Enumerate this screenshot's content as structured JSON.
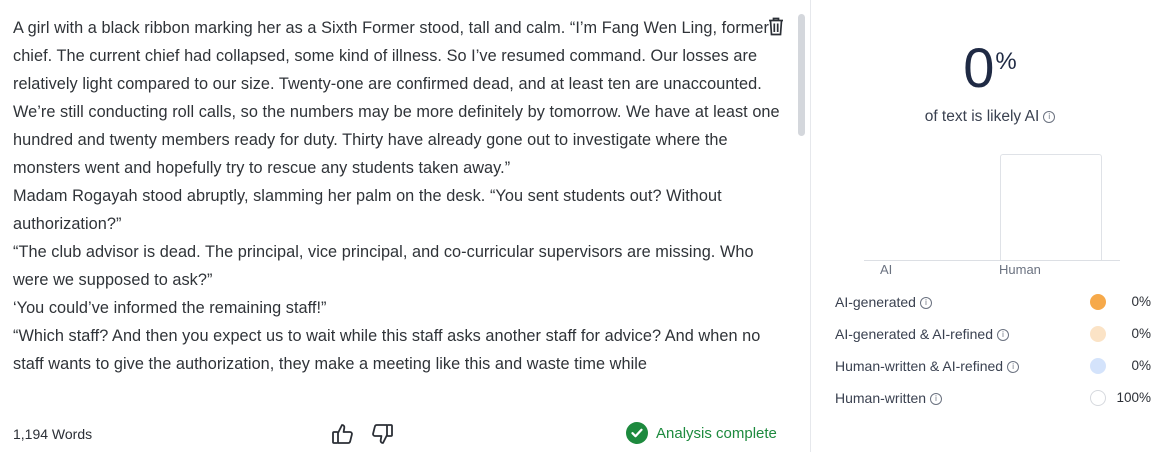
{
  "editor": {
    "paragraphs": [
      "A girl with a black ribbon marking her as a Sixth Former stood, tall and calm. “I’m Fang Wen Ling, former chief. The current chief had collapsed, some kind of illness. So I’ve resumed command. Our losses are relatively light compared to our size. Twenty-one are confirmed dead, and at least ten are unaccounted. We’re still conducting roll calls, so the numbers may be more definitely by tomorrow. We have at least one hundred and twenty members ready for duty. Thirty have already gone out to investigate where the monsters went and hopefully try to rescue any students taken away.”",
      "Madam Rogayah stood abruptly, slamming her palm on the desk. “You sent students out? Without authorization?”",
      "“The club advisor is dead. The principal, vice principal, and co-curricular supervisors are missing. Who were we supposed to ask?”",
      "‘You could’ve informed the remaining staff!”",
      "“Which staff? And then you expect us to wait while this staff asks another staff for advice? And when no staff wants to give the authorization, they make a meeting like this and waste time while"
    ],
    "word_count": "1,194 Words",
    "status": "Analysis complete",
    "icons": {
      "trash": "trash-icon",
      "thumbs_up": "thumbs-up-icon",
      "thumbs_down": "thumbs-down-icon",
      "status": "check-circle-icon"
    }
  },
  "results": {
    "percent": "0",
    "percent_sign": "%",
    "caption": "of text is likely AI",
    "colors": {
      "heading": "#1f2a44",
      "status_green": "#1d8a3e"
    },
    "chart_data": {
      "type": "bar",
      "categories": [
        "AI",
        "Human"
      ],
      "values": [
        0,
        100
      ],
      "ylim": [
        0,
        100
      ]
    },
    "legend": [
      {
        "label": "AI-generated",
        "value": "0%",
        "color": "#f6a94a",
        "outlined": false
      },
      {
        "label": "AI-generated & AI-refined",
        "value": "0%",
        "color": "#fbe3c6",
        "outlined": false
      },
      {
        "label": "Human-written & AI-refined",
        "value": "0%",
        "color": "#d4e3fb",
        "outlined": false
      },
      {
        "label": "Human-written",
        "value": "100%",
        "color": "#ffffff",
        "outlined": true
      }
    ]
  }
}
